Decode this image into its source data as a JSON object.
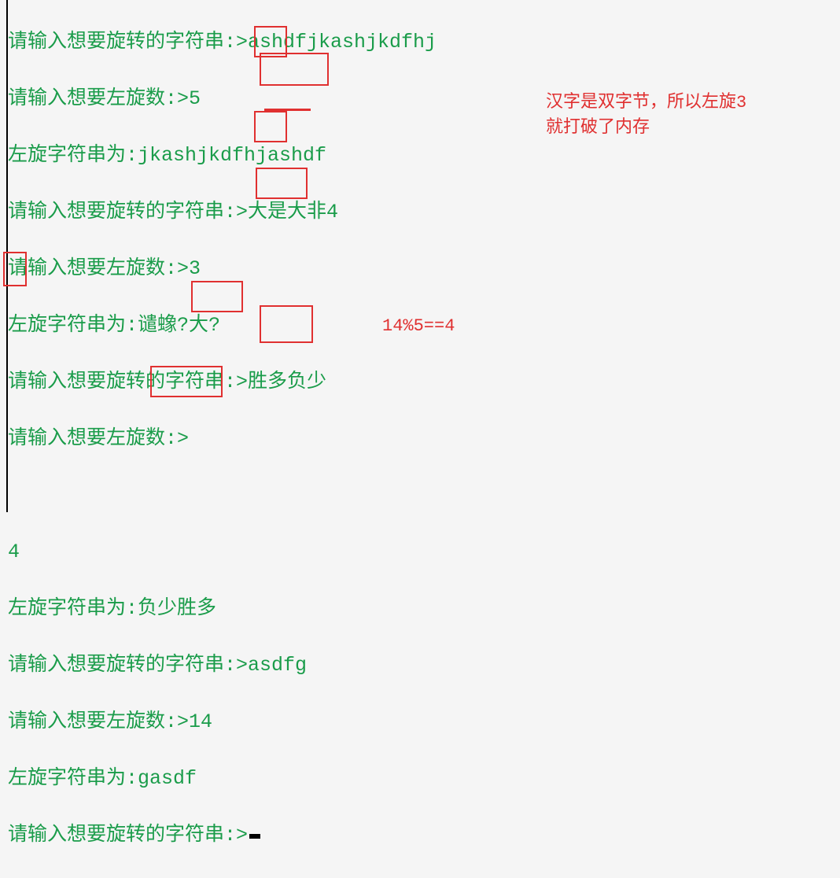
{
  "prompts": {
    "enter_string": "请输入想要旋转的字符串:>",
    "enter_shift": "请输入想要左旋数:>",
    "result": "左旋字符串为:"
  },
  "runs": [
    {
      "input_string": "ashdfjkashjkdfhj",
      "shift": "5",
      "result": "jkashjkdfhjashdf"
    },
    {
      "input_string": "大是大非4",
      "shift": "3",
      "result": "谴蟓?大?"
    },
    {
      "input_string": "胜多负少",
      "shift": "4",
      "result": "负少胜多",
      "shift_on_newline": true
    },
    {
      "input_string": "asdfg",
      "shift": "14",
      "result": "gasdf"
    }
  ],
  "final_prompt": "请输入想要旋转的字符串:>",
  "annotations": {
    "hanzi_note_line1": "汉字是双字节，所以左旋3",
    "hanzi_note_line2": "就打破了内存",
    "mod_note": "14%5==4"
  },
  "boxes": {
    "box_5": "5",
    "box_ashdf": "ashdf",
    "underline_dashi": "大是",
    "box_3": "3",
    "box_shengduo_in": "胜多",
    "box_4": "4",
    "box_shengduo_out": "胜多",
    "box_asdf": "asdf",
    "box_gasdf": "gasdf"
  }
}
